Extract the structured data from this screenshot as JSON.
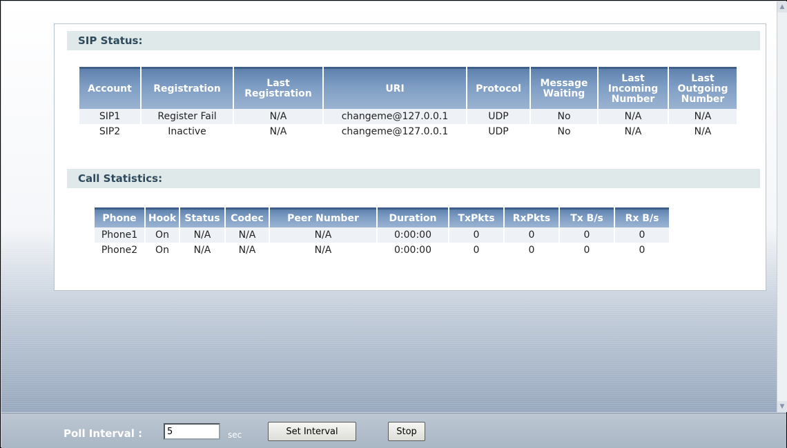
{
  "sip_status": {
    "title": "SIP Status:",
    "headers": [
      [
        "Account"
      ],
      [
        "Registration"
      ],
      [
        "Last",
        "Registration"
      ],
      [
        "URI"
      ],
      [
        "Protocol"
      ],
      [
        "Message",
        "Waiting"
      ],
      [
        "Last",
        "Incoming",
        "Number"
      ],
      [
        "Last",
        "Outgoing",
        "Number"
      ]
    ],
    "rows": [
      [
        "SIP1",
        "Register Fail",
        "N/A",
        "changeme@127.0.0.1",
        "UDP",
        "No",
        "N/A",
        "N/A"
      ],
      [
        "SIP2",
        "Inactive",
        "N/A",
        "changeme@127.0.0.1",
        "UDP",
        "No",
        "N/A",
        "N/A"
      ]
    ]
  },
  "call_statistics": {
    "title": "Call Statistics:",
    "headers": [
      "Phone",
      "Hook",
      "Status",
      "Codec",
      "Peer Number",
      "Duration",
      "TxPkts",
      "RxPkts",
      "Tx B/s",
      "Rx B/s"
    ],
    "rows": [
      [
        "Phone1",
        "On",
        "N/A",
        "N/A",
        "N/A",
        "0:00:00",
        "0",
        "0",
        "0",
        "0"
      ],
      [
        "Phone2",
        "On",
        "N/A",
        "N/A",
        "N/A",
        "0:00:00",
        "0",
        "0",
        "0",
        "0"
      ]
    ]
  },
  "poll": {
    "label": "Poll Interval :",
    "value": "5",
    "unit": "sec",
    "set_button": "Set Interval",
    "stop_button": "Stop"
  },
  "scrollbar": {
    "up_icon": "scroll-up-arrow-icon",
    "down_icon": "scroll-down-arrow-icon"
  }
}
